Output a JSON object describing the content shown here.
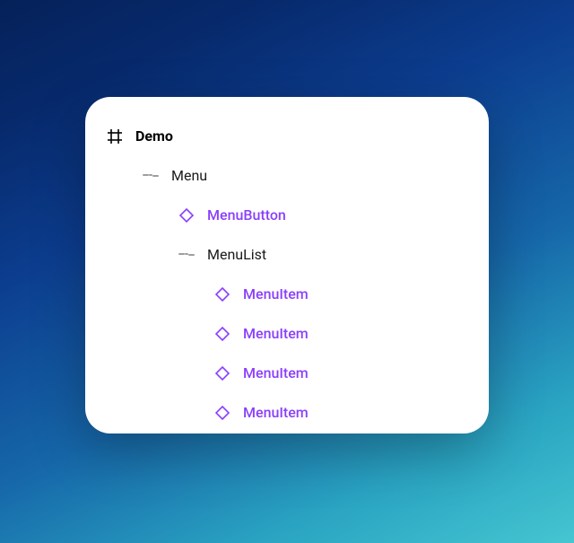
{
  "colors": {
    "component_purple": "#8a3ffc",
    "frame_black": "#000000",
    "group_gray": "#9e9e9e"
  },
  "tree": {
    "root": {
      "label": "Demo",
      "icon": "frame-icon"
    },
    "menu": {
      "label": "Menu",
      "icon": "group-lines-icon"
    },
    "menuButton": {
      "label": "MenuButton",
      "icon": "component-diamond-icon"
    },
    "menuList": {
      "label": "MenuList",
      "icon": "group-lines-icon"
    },
    "menuItems": [
      {
        "label": "MenuItem",
        "icon": "component-diamond-icon"
      },
      {
        "label": "MenuItem",
        "icon": "component-diamond-icon"
      },
      {
        "label": "MenuItem",
        "icon": "component-diamond-icon"
      },
      {
        "label": "MenuItem",
        "icon": "component-diamond-icon"
      }
    ]
  }
}
